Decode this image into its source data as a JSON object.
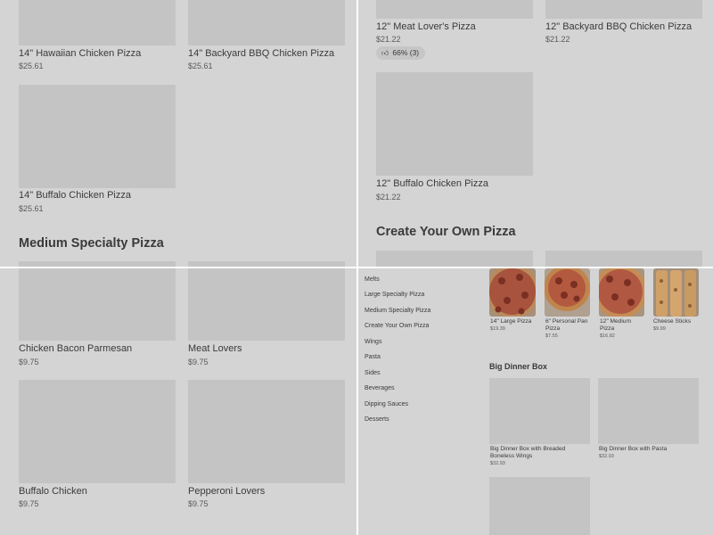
{
  "top_left": {
    "cards": [
      {
        "name": "14\" Hawaiian Chicken Pizza",
        "price": "$25.61"
      },
      {
        "name": "14\" Backyard BBQ Chicken Pizza",
        "price": "$25.61"
      },
      {
        "name": "14\" Buffalo Chicken Pizza",
        "price": "$25.61"
      }
    ],
    "section_title": "Medium Specialty Pizza"
  },
  "top_right": {
    "cards": [
      {
        "name": "12\" Meat Lover's Pizza",
        "price": "$21.22",
        "rating": "66% (3)"
      },
      {
        "name": "12\" Backyard BBQ Chicken Pizza",
        "price": "$21.22"
      },
      {
        "name": "12\" Buffalo Chicken Pizza",
        "price": "$21.22"
      }
    ],
    "section_title": "Create Your Own Pizza"
  },
  "bottom_left": {
    "cards": [
      {
        "name": "Chicken Bacon Parmesan",
        "price": "$9.75"
      },
      {
        "name": "Meat Lovers",
        "price": "$9.75"
      },
      {
        "name": "Buffalo Chicken",
        "price": "$9.75"
      },
      {
        "name": "Pepperoni Lovers",
        "price": "$9.75"
      }
    ]
  },
  "bottom_right": {
    "nav": [
      "Melts",
      "Large Specialty Pizza",
      "Medium Specialty Pizza",
      "Create Your Own Pizza",
      "Wings",
      "Pasta",
      "Sides",
      "Beverages",
      "Dipping Sauces",
      "Desserts"
    ],
    "featured": [
      {
        "name": "14\" Large Pizza",
        "price": "$19.39"
      },
      {
        "name": "6\" Personal Pan Pizza",
        "price": "$7.55"
      },
      {
        "name": "12\" Medium Pizza",
        "price": "$16.82"
      },
      {
        "name": "Cheese Sticks",
        "price": "$9.99"
      }
    ],
    "dinner_box_title": "Big Dinner Box",
    "dinner_boxes": [
      {
        "name": "Big Dinner Box with Breaded Boneless Wings",
        "price": "$32.93"
      },
      {
        "name": "Big Dinner Box with Pasta",
        "price": "$32.93"
      }
    ]
  },
  "icons": {
    "rating": "thumbs-up-icon"
  }
}
